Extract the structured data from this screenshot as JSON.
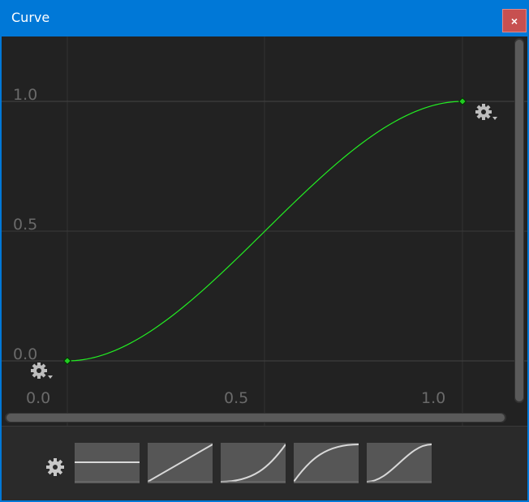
{
  "window": {
    "title": "Curve",
    "close_label": "×"
  },
  "chart_data": {
    "type": "line",
    "series": [
      {
        "values": [
          [
            0.0,
            0.0
          ],
          [
            1.0,
            1.0
          ]
        ],
        "interpolation": "ease-in-out",
        "color": "#22ee22"
      }
    ],
    "keyframes": [
      [
        0.0,
        0.0
      ],
      [
        1.0,
        1.0
      ]
    ],
    "x_ticks": [
      "0.0",
      "0.5",
      "1.0"
    ],
    "y_ticks": [
      "0.0",
      "0.5",
      "1.0"
    ],
    "xlim": [
      -0.15,
      1.15
    ],
    "ylim": [
      -0.2,
      1.25
    ],
    "grid": true
  },
  "presets": [
    {
      "name": "constant"
    },
    {
      "name": "linear"
    },
    {
      "name": "ease-in"
    },
    {
      "name": "ease-out"
    },
    {
      "name": "ease-in-out"
    }
  ],
  "colors": {
    "curve": "#22ee22",
    "background": "#222222",
    "grid": "#3a3a3a",
    "accent": "#0078d7"
  },
  "icons": {
    "settings": "gear-icon",
    "close": "close-icon"
  }
}
